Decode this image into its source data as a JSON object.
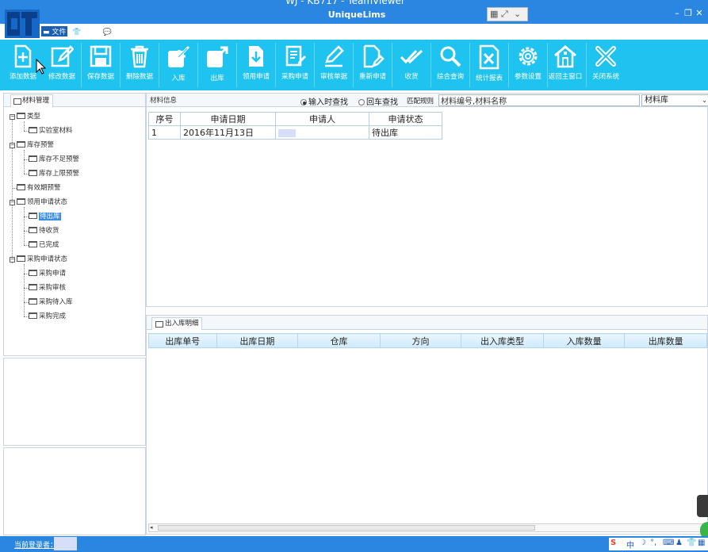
{
  "window": {
    "partial_caption": "WJ - KB717 - TeamViewer",
    "app_title": "UniqueLims"
  },
  "menu": [
    {
      "label": "文件",
      "active": true
    },
    {
      "label": "主题",
      "active": false
    },
    {
      "label": "关于",
      "active": false
    }
  ],
  "toolbar": [
    {
      "label": "添加数据",
      "icon": "add-document-icon"
    },
    {
      "label": "修改数据",
      "icon": "edit-icon"
    },
    {
      "label": "保存数据",
      "icon": "save-icon"
    },
    {
      "label": "删除数据",
      "icon": "trash-icon"
    },
    {
      "label": "入库",
      "icon": "stock-in-icon"
    },
    {
      "label": "出库",
      "icon": "stock-out-icon"
    },
    {
      "label": "领用申请",
      "icon": "download-doc-icon"
    },
    {
      "label": "采购申请",
      "icon": "purchase-doc-icon"
    },
    {
      "label": "审核单据",
      "icon": "pen-icon"
    },
    {
      "label": "重新申请",
      "icon": "reapply-doc-icon"
    },
    {
      "label": "收货",
      "icon": "double-check-icon"
    },
    {
      "label": "综合查询",
      "icon": "search-icon"
    },
    {
      "label": "统计报表",
      "icon": "excel-icon"
    },
    {
      "label": "参数设置",
      "icon": "gear-icon"
    },
    {
      "label": "返回主窗口",
      "icon": "home-icon"
    },
    {
      "label": "关闭系统",
      "icon": "close-icon"
    }
  ],
  "left_panel": {
    "tab_label": "材料管理",
    "tree": [
      {
        "label": "类型",
        "level": 0,
        "expander": "minus"
      },
      {
        "label": "实验室材料",
        "level": 1
      },
      {
        "label": "库存预警",
        "level": 0,
        "expander": "minus"
      },
      {
        "label": "库存不足预警",
        "level": 1
      },
      {
        "label": "库存上限预警",
        "level": 1
      },
      {
        "label": "有效期预警",
        "level": 0
      },
      {
        "label": "领用申请状态",
        "level": 0,
        "expander": "minus"
      },
      {
        "label": "待出库",
        "level": 1,
        "selected": true
      },
      {
        "label": "待收货",
        "level": 1
      },
      {
        "label": "已完成",
        "level": 1
      },
      {
        "label": "采购申请状态",
        "level": 0,
        "expander": "minus"
      },
      {
        "label": "采购申请",
        "level": 1
      },
      {
        "label": "采购审核",
        "level": 1
      },
      {
        "label": "采购待入库",
        "level": 1
      },
      {
        "label": "采购完成",
        "level": 1
      }
    ]
  },
  "search_bar": {
    "section_label": "材料信息",
    "radio_enter": "输入时查找",
    "radio_return": "回车查找",
    "match_label": "匹配规则",
    "input_value": "材料编号,材料名称",
    "library_value": "材料库"
  },
  "requests_table": {
    "columns": [
      "序号",
      "申请日期",
      "申请人",
      "申请状态"
    ],
    "rows": [
      [
        "1",
        "2016年11月13日",
        "",
        "待出库"
      ]
    ]
  },
  "detail_panel": {
    "tab_label": "出入库明细",
    "columns": [
      "出库单号",
      "出库日期",
      "仓库",
      "方向",
      "出入库类型",
      "入库数量",
      "出库数量"
    ]
  },
  "status_bar": {
    "login_label": "当前登录者："
  },
  "colors": {
    "title_bar": "#2a86e0",
    "toolbar": "#1ec3f0",
    "selection": "#3a8ee6"
  }
}
